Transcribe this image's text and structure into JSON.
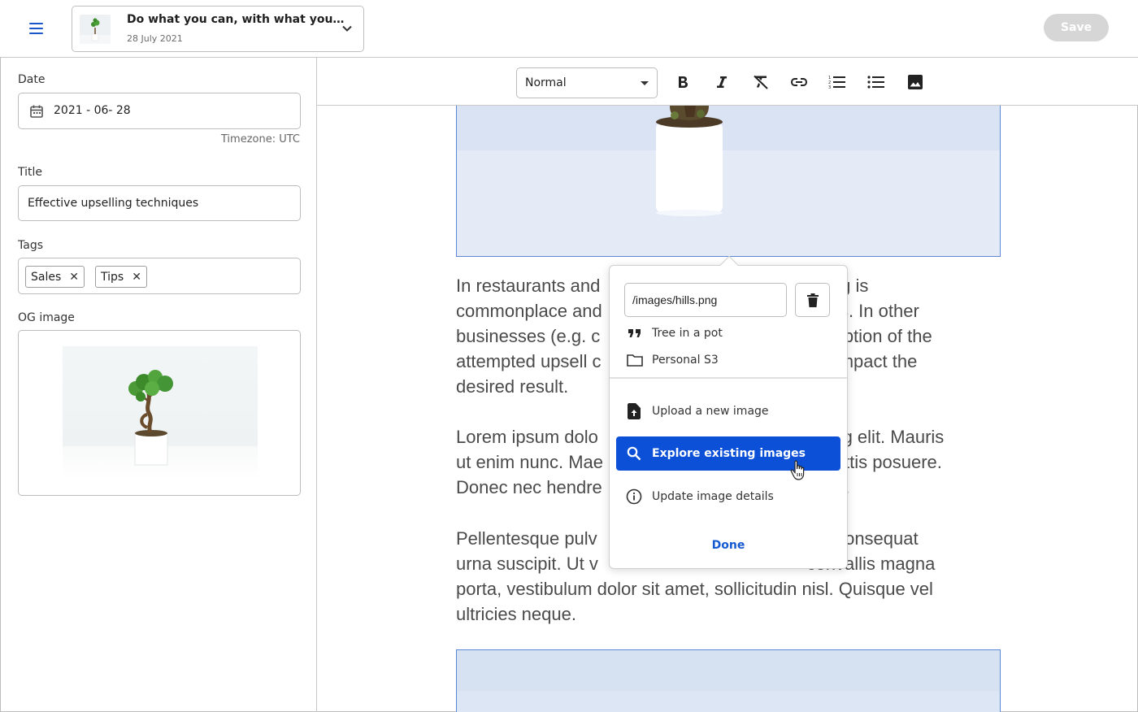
{
  "topbar": {
    "document": {
      "title": "Do what you can, with what you…",
      "date": "28 July 2021"
    },
    "save_label": "Save"
  },
  "sidebar": {
    "date": {
      "label": "Date",
      "value": "2021 - 06- 28",
      "timezone": "Timezone: UTC"
    },
    "title": {
      "label": "Title",
      "value": "Effective upselling techniques"
    },
    "tags": {
      "label": "Tags",
      "items": [
        "Sales",
        "Tips"
      ],
      "remove_glyph": "✕"
    },
    "og_image": {
      "label": "OG image"
    }
  },
  "toolbar": {
    "format": "Normal",
    "tools": [
      "bold-icon",
      "italic-icon",
      "clear-format-icon",
      "link-icon",
      "numbered-list-icon",
      "bullet-list-icon",
      "image-icon"
    ]
  },
  "editor": {
    "paragraphs": [
      "In restaurants and                                          elling is\ncommonplace and                                          ness. In other\nbusinesses (e.g. c                                          erception of the\nattempted upsell c                                          nd impact the\ndesired result.",
      "Lorem ipsum dolo                                          iscing elit. Mauris\nut enim nunc. Mae                                          sagittis posuere.\nDonec nec hendre                                          usto.",
      "Pellentesque pulv                                          , at consequat\nurna suscipit. Ut v                                          convallis magna\nporta, vestibulum dolor sit amet, sollicitudin nisl. Quisque vel\nultricies neque."
    ]
  },
  "image_popover": {
    "path": "/images/hills.png",
    "alt_text": "Tree in a pot",
    "source": "Personal S3",
    "actions": {
      "upload": "Upload a new image",
      "explore": "Explore existing images",
      "details": "Update image details"
    },
    "done_label": "Done",
    "accent_color": "#0d50d8"
  }
}
